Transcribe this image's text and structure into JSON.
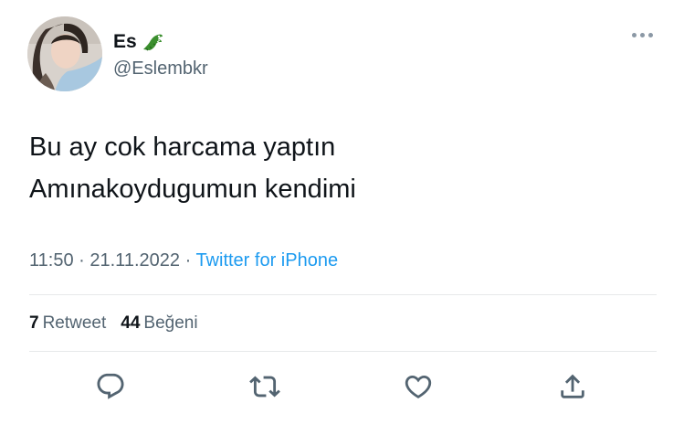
{
  "author": {
    "display_name": "Es",
    "handle": "@Eslembkr",
    "name_emoji": "crocodile-emoji"
  },
  "tweet": {
    "text_line1": "Bu ay cok harcama yaptın",
    "text_line2": "Amınakoydugumun kendimi",
    "time": "11:50",
    "date": "21.11.2022",
    "separator": "·",
    "source": "Twitter for iPhone"
  },
  "stats": {
    "retweet_count": "7",
    "retweet_label": "Retweet",
    "like_count": "44",
    "like_label": "Beğeni"
  },
  "icons": {
    "more": "more-icon",
    "reply": "reply-icon",
    "retweet": "retweet-icon",
    "like": "like-icon",
    "share": "share-icon"
  },
  "colors": {
    "text": "#0f1419",
    "secondary": "#536471",
    "link": "#1d9bf0",
    "divider": "#e7e9ea"
  }
}
